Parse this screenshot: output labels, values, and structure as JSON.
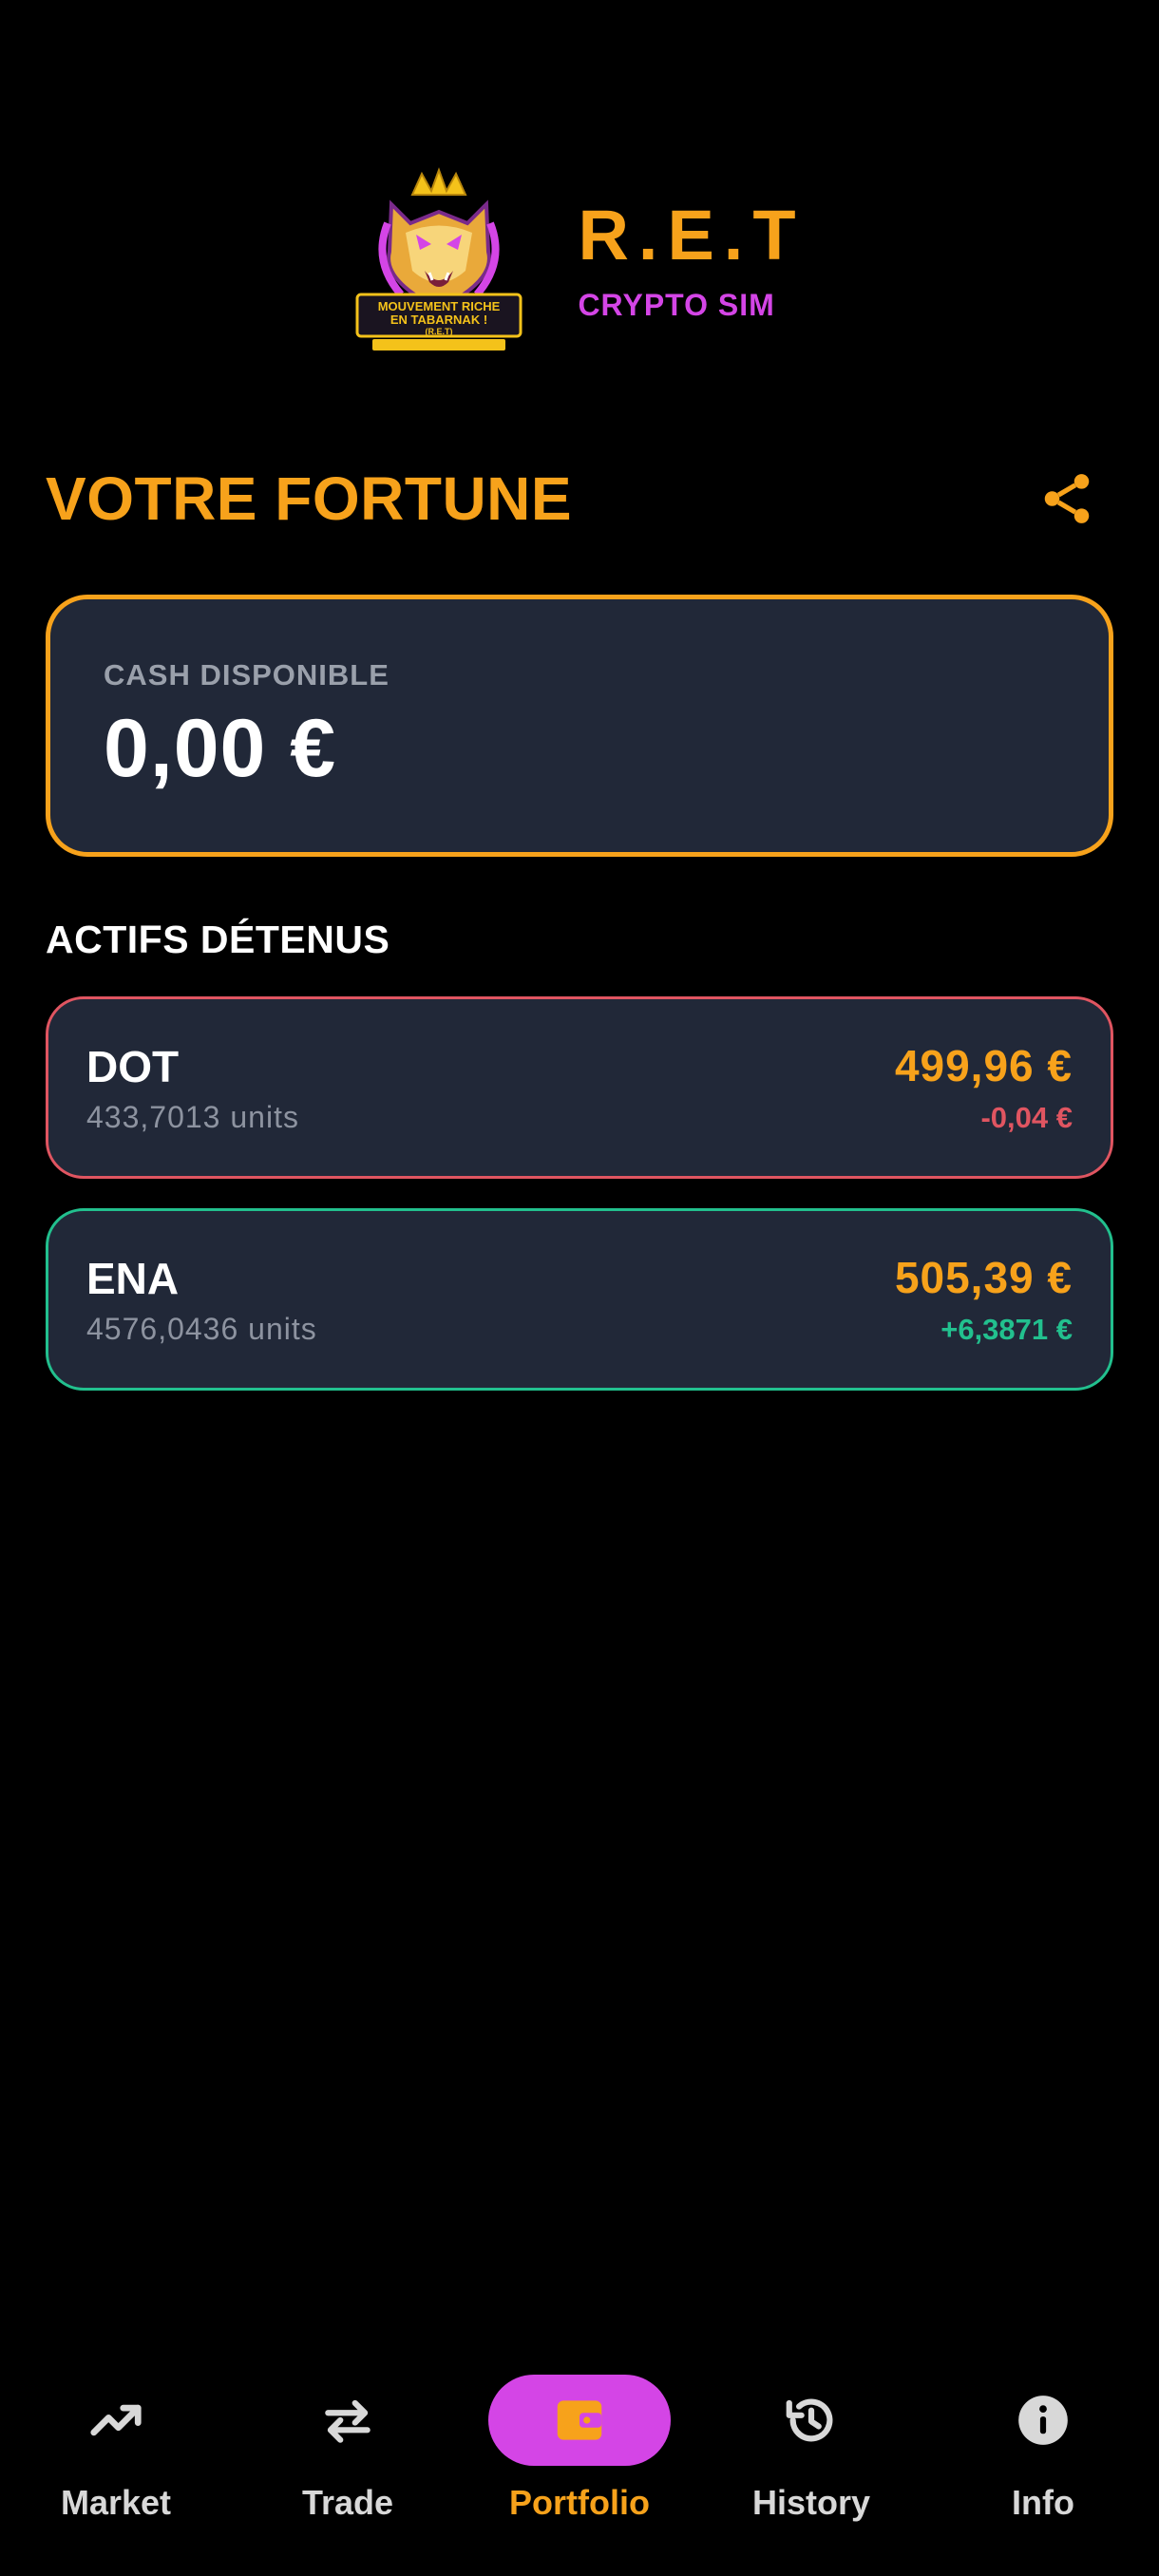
{
  "brand": {
    "title": "R.E.T",
    "subtitle": "CRYPTO SIM",
    "logo_text_line1": "MOUVEMENT RICHE",
    "logo_text_line2": "EN TABARNAK !",
    "logo_text_line3": "(R.E.T)"
  },
  "header": {
    "title": "VOTRE FORTUNE",
    "share_icon": "share-icon"
  },
  "cash": {
    "label": "CASH DISPONIBLE",
    "value": "0,00 €"
  },
  "assets": {
    "title": "ACTIFS DÉTENUS",
    "items": [
      {
        "symbol": "DOT",
        "units": "433,7013 units",
        "value": "499,96 €",
        "change": "-0,04 €",
        "status_color": "#e05561"
      },
      {
        "symbol": "ENA",
        "units": "4576,0436 units",
        "value": "505,39 €",
        "change": "+6,3871 €",
        "status_color": "#22c08e"
      }
    ]
  },
  "nav": {
    "active": "Portfolio",
    "items": [
      {
        "label": "Market",
        "icon": "trending-up-icon"
      },
      {
        "label": "Trade",
        "icon": "swap-arrows-icon"
      },
      {
        "label": "Portfolio",
        "icon": "wallet-icon"
      },
      {
        "label": "History",
        "icon": "history-icon"
      },
      {
        "label": "Info",
        "icon": "info-icon"
      }
    ]
  },
  "colors": {
    "accent": "#f7a21b",
    "brand_purple": "#d445e6",
    "card_bg": "#212838",
    "negative": "#e05561",
    "positive": "#22c08e"
  }
}
